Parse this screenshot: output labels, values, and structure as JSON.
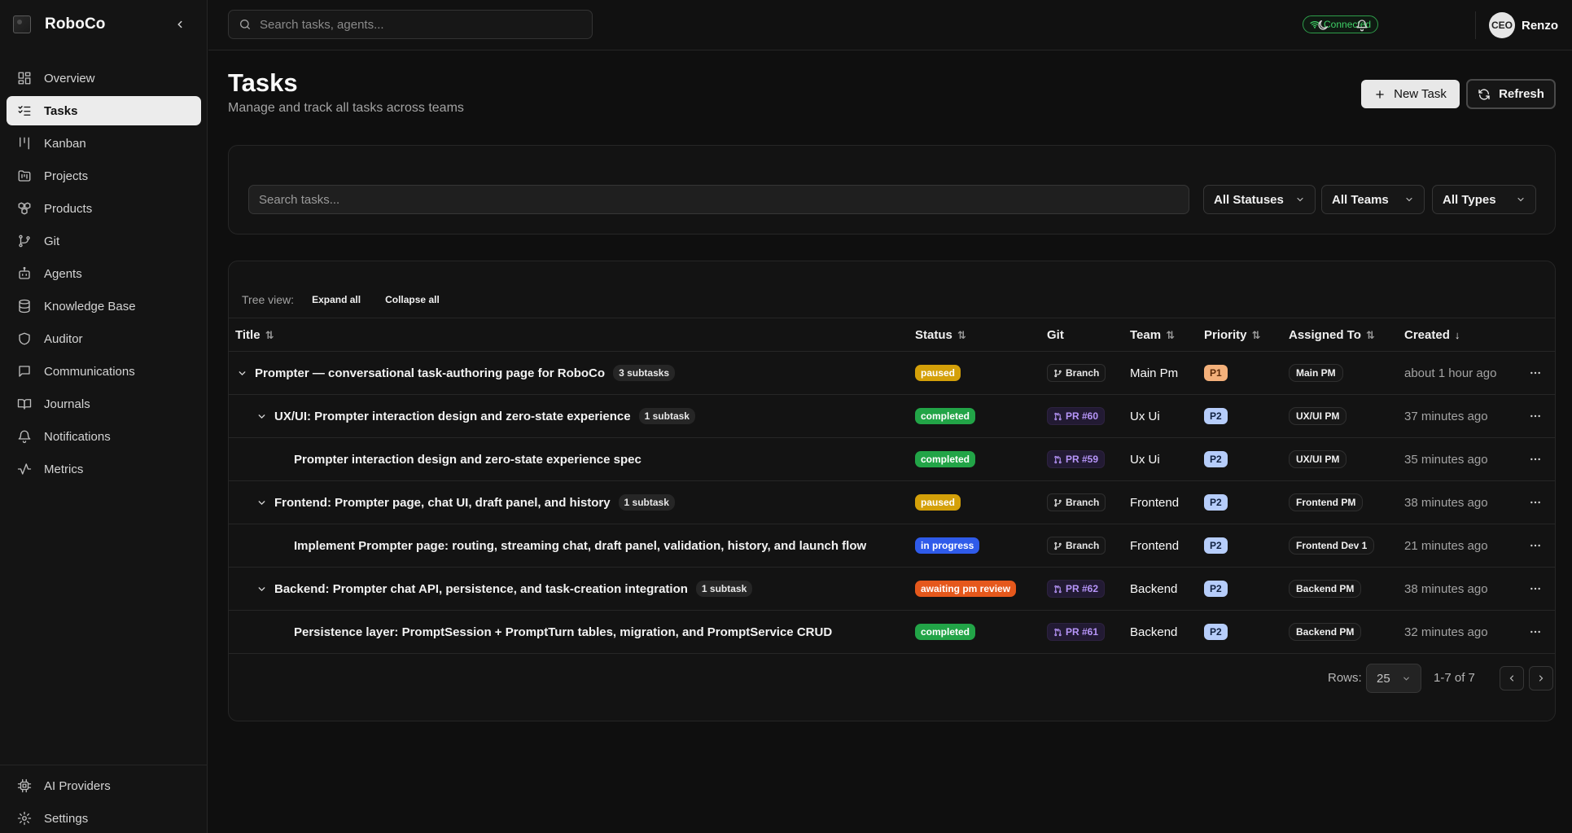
{
  "app": {
    "name": "RoboCo"
  },
  "sidebar": {
    "items": [
      {
        "label": "Overview",
        "icon": "layout-grid-icon",
        "active": false
      },
      {
        "label": "Tasks",
        "icon": "list-checks-icon",
        "active": true
      },
      {
        "label": "Kanban",
        "icon": "kanban-icon",
        "active": false
      },
      {
        "label": "Projects",
        "icon": "folder-kanban-icon",
        "active": false
      },
      {
        "label": "Products",
        "icon": "boxes-icon",
        "active": false
      },
      {
        "label": "Git",
        "icon": "git-branch-icon",
        "active": false
      },
      {
        "label": "Agents",
        "icon": "bot-icon",
        "active": false
      },
      {
        "label": "Knowledge Base",
        "icon": "database-icon",
        "active": false
      },
      {
        "label": "Auditor",
        "icon": "shield-icon",
        "active": false
      },
      {
        "label": "Communications",
        "icon": "message-square-icon",
        "active": false
      },
      {
        "label": "Journals",
        "icon": "book-open-icon",
        "active": false
      },
      {
        "label": "Notifications",
        "icon": "bell-icon",
        "active": false
      },
      {
        "label": "Metrics",
        "icon": "activity-icon",
        "active": false
      }
    ],
    "bottom_items": [
      {
        "label": "AI Providers",
        "icon": "cpu-icon"
      },
      {
        "label": "Settings",
        "icon": "gear-icon"
      }
    ]
  },
  "header": {
    "search_placeholder": "Search tasks, agents...",
    "connection_status": "Connected",
    "user": {
      "initials": "CEO",
      "name": "Renzo"
    }
  },
  "page": {
    "title": "Tasks",
    "subtitle": "Manage and track all tasks across teams",
    "new_task_label": "New Task",
    "refresh_label": "Refresh"
  },
  "filters": {
    "search_placeholder": "Search tasks...",
    "status": "All Statuses",
    "team": "All Teams",
    "type": "All Types"
  },
  "tree": {
    "label": "Tree view:",
    "expand_all": "Expand all",
    "collapse_all": "Collapse all"
  },
  "table": {
    "columns": {
      "title": "Title",
      "status": "Status",
      "git": "Git",
      "team": "Team",
      "priority": "Priority",
      "assigned": "Assigned To",
      "created": "Created"
    },
    "rows": [
      {
        "depth": 0,
        "expandable": true,
        "title": "Prompter — conversational task-authoring page for RoboCo",
        "subtasks": "3 subtasks",
        "status": "paused",
        "git": "Branch",
        "git_kind": "branch",
        "team": "Main Pm",
        "priority": "P1",
        "assigned": "Main PM",
        "created": "about 1 hour ago"
      },
      {
        "depth": 1,
        "expandable": true,
        "title": "UX/UI: Prompter interaction design and zero-state experience",
        "subtasks": "1 subtask",
        "status": "completed",
        "git": "PR #60",
        "git_kind": "pr",
        "team": "Ux Ui",
        "priority": "P2",
        "assigned": "UX/UI PM",
        "created": "37 minutes ago"
      },
      {
        "depth": 2,
        "expandable": false,
        "title": "Prompter interaction design and zero-state experience spec",
        "subtasks": "",
        "status": "completed",
        "git": "PR #59",
        "git_kind": "pr",
        "team": "Ux Ui",
        "priority": "P2",
        "assigned": "UX/UI PM",
        "created": "35 minutes ago"
      },
      {
        "depth": 1,
        "expandable": true,
        "title": "Frontend: Prompter page, chat UI, draft panel, and history",
        "subtasks": "1 subtask",
        "status": "paused",
        "git": "Branch",
        "git_kind": "branch",
        "team": "Frontend",
        "priority": "P2",
        "assigned": "Frontend PM",
        "created": "38 minutes ago"
      },
      {
        "depth": 2,
        "expandable": false,
        "title": "Implement Prompter page: routing, streaming chat, draft panel, validation, history, and launch flow",
        "subtasks": "",
        "status": "in progress",
        "git": "Branch",
        "git_kind": "branch",
        "team": "Frontend",
        "priority": "P2",
        "assigned": "Frontend Dev 1",
        "created": "21 minutes ago"
      },
      {
        "depth": 1,
        "expandable": true,
        "title": "Backend: Prompter chat API, persistence, and task-creation integration",
        "subtasks": "1 subtask",
        "status": "awaiting pm review",
        "git": "PR #62",
        "git_kind": "pr",
        "team": "Backend",
        "priority": "P2",
        "assigned": "Backend PM",
        "created": "38 minutes ago"
      },
      {
        "depth": 2,
        "expandable": false,
        "title": "Persistence layer: PromptSession + PromptTurn tables, migration, and PromptService CRUD",
        "subtasks": "",
        "status": "completed",
        "git": "PR #61",
        "git_kind": "pr",
        "team": "Backend",
        "priority": "P2",
        "assigned": "Backend PM",
        "created": "32 minutes ago"
      }
    ]
  },
  "pagination": {
    "rows_label": "Rows:",
    "rows_value": "25",
    "range": "1-7 of 7"
  },
  "colors": {
    "paused": "#d4a009",
    "completed": "#22a447",
    "in progress": "#2f5bea",
    "awaiting pm review": "#e5581c",
    "P1": "#f3b07a",
    "P2": "#b6cdfa"
  }
}
